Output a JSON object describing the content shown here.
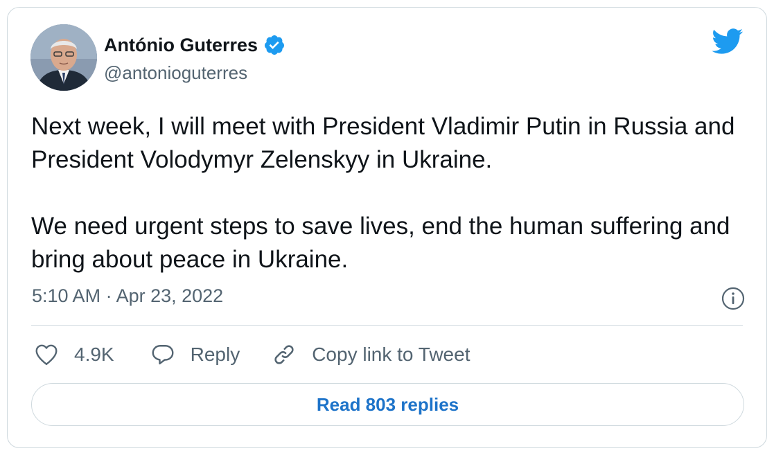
{
  "author": {
    "name": "António Guterres",
    "handle": "@antonioguterres",
    "verified": true,
    "avatar_icon": "profile-photo"
  },
  "tweet": {
    "paragraphs": [
      "Next week, I will meet with President Vladimir Putin in Russia and President Volodymyr Zelenskyy in Ukraine.",
      "We need urgent steps to save lives, end the human suffering and bring about peace in Ukraine."
    ],
    "timestamp": "5:10 AM · Apr 23, 2022"
  },
  "actions": {
    "like_count": "4.9K",
    "reply_label": "Reply",
    "copy_link_label": "Copy link to Tweet"
  },
  "read_replies_label": "Read 803 replies",
  "icons": {
    "brand": "twitter-bird-icon",
    "info": "info-icon",
    "like": "heart-icon",
    "reply": "speech-bubble-icon",
    "link": "link-icon",
    "verified": "verified-badge-icon"
  },
  "colors": {
    "brand_blue": "#1d9bf0",
    "link_blue": "#1d73c9",
    "secondary_text": "#536471",
    "border": "#cfd9de"
  }
}
